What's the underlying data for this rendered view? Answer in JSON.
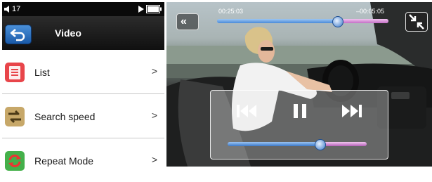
{
  "status": {
    "volume": "17"
  },
  "menu": {
    "title": "Video",
    "items": [
      {
        "label": "List",
        "icon": "list-icon",
        "color": "#e8454a"
      },
      {
        "label": "Search speed",
        "icon": "search-speed-icon",
        "color": "#c7a869"
      },
      {
        "label": "Repeat Mode",
        "icon": "repeat-icon",
        "color": "#44b04a"
      }
    ],
    "arrow": ">"
  },
  "player": {
    "elapsed": "00:25:03",
    "remaining": "–00:05:05",
    "seek_progress": 0.7,
    "volume_level": 0.66,
    "colors": {
      "played": "#4a8ad8",
      "unplayed": "#c46ec6"
    }
  }
}
